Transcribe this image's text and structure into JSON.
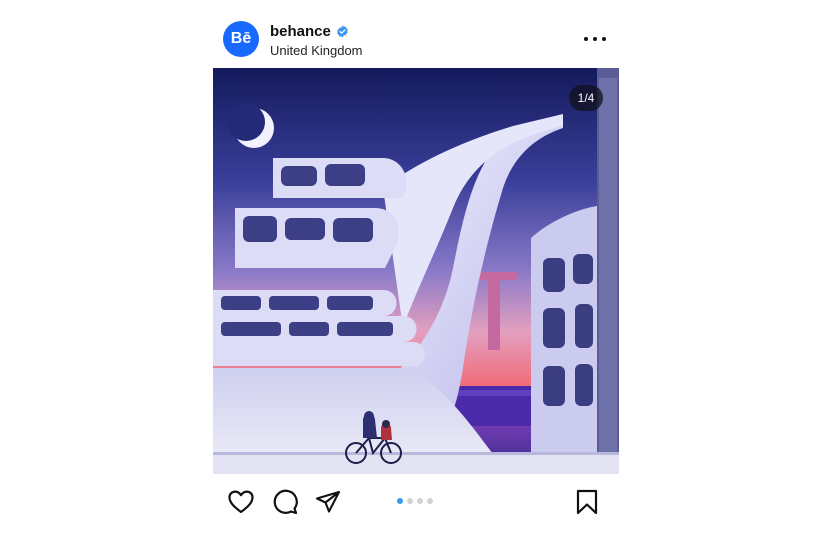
{
  "post": {
    "username": "behance",
    "avatar_text": "Bē",
    "location": "United Kingdom",
    "verified": true,
    "image_counter": "1/4",
    "carousel": {
      "total": 4,
      "active": 1
    }
  },
  "colors": {
    "brand_blue": "#1769ff",
    "verified_blue": "#3897f0",
    "dot_inactive": "#d2d2d2"
  },
  "icons": [
    "verified-badge-icon",
    "more-options-icon",
    "like-heart-icon",
    "comment-icon",
    "share-icon",
    "save-bookmark-icon"
  ]
}
